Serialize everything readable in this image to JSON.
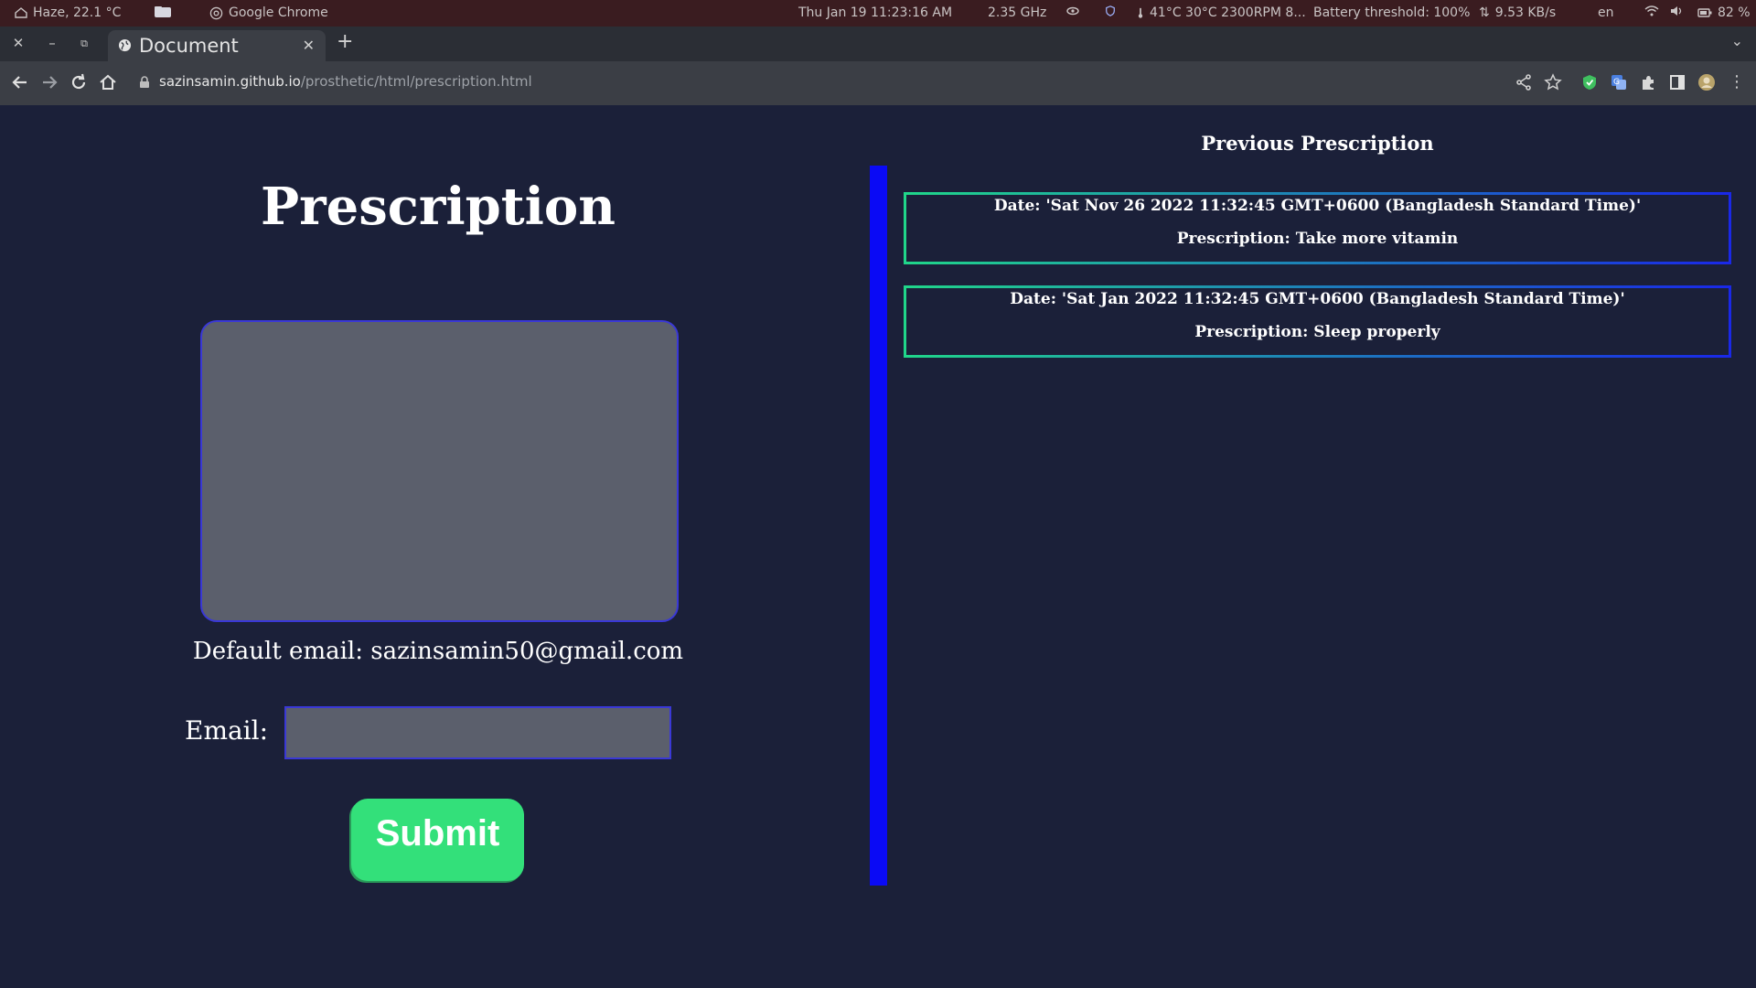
{
  "os_bar": {
    "weather": "Haze, 22.1 °C",
    "app_name": "Google Chrome",
    "datetime": "Thu Jan 19  11:23:16 AM",
    "cpu_freq": "2.35 GHz",
    "sensors": "41°C 30°C 2300RPM 8...",
    "battery_threshold": "Battery threshold: 100%",
    "network": "9.53 KB/s",
    "language": "en",
    "battery": "82 %"
  },
  "browser": {
    "tab_title": "Document",
    "url_host": "sazinsamin.github.io",
    "url_path": "/prosthetic/html/prescription.html"
  },
  "page": {
    "heading": "Prescription",
    "default_email": "Default email: sazinsamin50@gmail.com",
    "email_label": "Email:",
    "email_value": "",
    "submit_label": "Submit",
    "previous_title": "Previous Prescription",
    "prescriptions": [
      {
        "date": "Date: 'Sat Nov 26 2022 11:32:45 GMT+0600 (Bangladesh Standard Time)'",
        "text": "Prescription: Take more vitamin"
      },
      {
        "date": "Date: 'Sat Jan 2022 11:32:45 GMT+0600 (Bangladesh Standard Time)'",
        "text": "Prescription: Sleep properly"
      }
    ]
  },
  "colors": {
    "page_bg": "#1b2039",
    "divider": "#0a0af5",
    "submit_bg": "#33e07a",
    "input_bg": "#5b5f6c"
  }
}
